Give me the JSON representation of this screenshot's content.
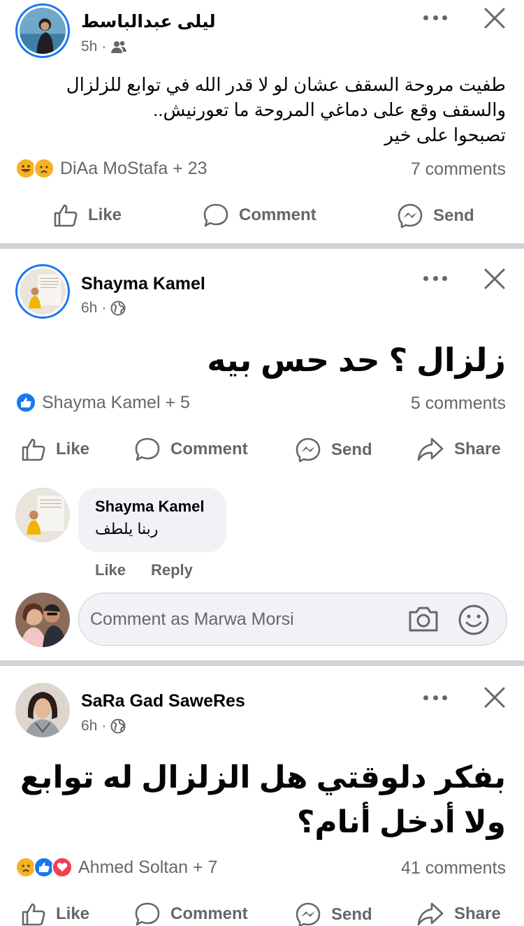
{
  "posts": [
    {
      "author": "ليلى عبدالباسط",
      "time": "5h",
      "body": [
        "طفيت مروحة السقف عشان لو لا قدر الله في توابع للزلزال",
        "والسقف وقع على دماغي المروحة ما تعورنيش..",
        "تصبحوا على خير"
      ],
      "reactions_text": "DiAa MoStafa + 23",
      "comments_count": "7 comments",
      "actions": {
        "like": "Like",
        "comment": "Comment",
        "send": "Send"
      }
    },
    {
      "author": "Shayma Kamel",
      "time": "6h",
      "body": "زلزال ؟ حد حس بيه",
      "reactions_text": "Shayma Kamel + 5",
      "comments_count": "5 comments",
      "actions": {
        "like": "Like",
        "comment": "Comment",
        "send": "Send",
        "share": "Share"
      },
      "comment": {
        "author": "Shayma Kamel",
        "text": "ربنا يلطف",
        "like": "Like",
        "reply": "Reply"
      },
      "comment_input_placeholder": "Comment as Marwa Morsi"
    },
    {
      "author": "SaRa Gad SaweRes",
      "time": "6h",
      "body": [
        "بفكر دلوقتي هل الزلزال له توابع",
        "ولا أدخل أنام؟"
      ],
      "reactions_text": "Ahmed Soltan + 7",
      "comments_count": "41 comments",
      "actions": {
        "like": "Like",
        "comment": "Comment",
        "send": "Send",
        "share": "Share"
      }
    }
  ],
  "colors": {
    "accent": "#1877f2",
    "secondary_text": "#65676b",
    "separator": "#cfd2d6",
    "love": "#f33e58",
    "haha": "#f7b125"
  }
}
